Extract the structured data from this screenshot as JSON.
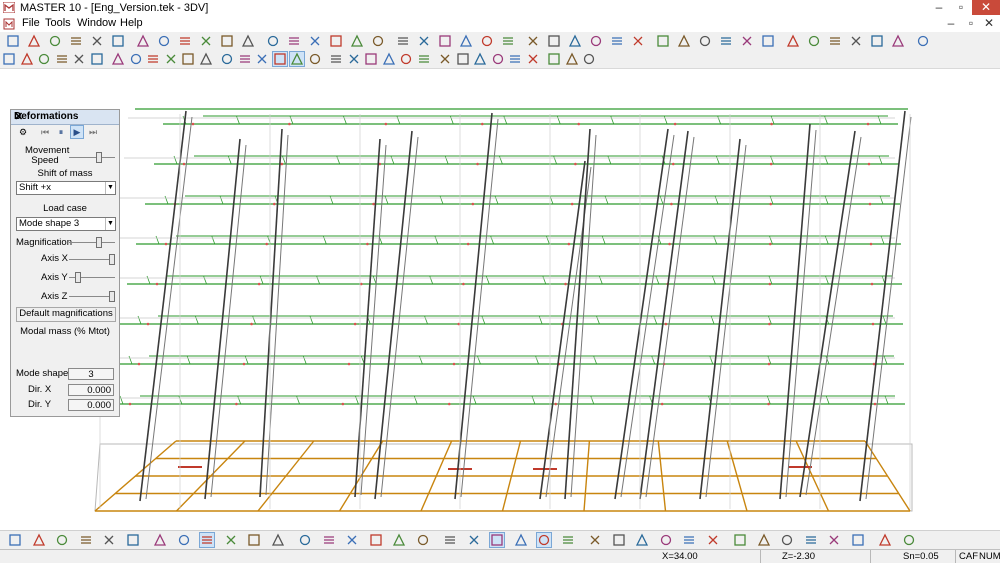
{
  "window": {
    "title": "MASTER 10 - [Eng_Version.tek - 3DV]"
  },
  "menu": {
    "file": "File",
    "tools": "Tools",
    "window": "Window",
    "help": "Help"
  },
  "panel": {
    "title": "Deformations",
    "movement_speed_label": "Movement\nSpeed",
    "shift_of_mass_label": "Shift of mass",
    "shift_value": "Shift +x",
    "load_case_label": "Load case",
    "load_case_value": "Mode shape 3",
    "magnification_label": "Magnification",
    "axis_x_label": "Axis X",
    "axis_y_label": "Axis Y",
    "axis_z_label": "Axis Z",
    "default_magnifications_label": "Default magnifications",
    "modal_mass_label": "Modal mass (% Mtot)",
    "mode_shape_label": "Mode shape",
    "mode_shape_value": "3",
    "dir_x_label": "Dir. X",
    "dir_x_value": "0.000",
    "dir_y_label": "Dir. Y",
    "dir_y_value": "0.000",
    "sliders": {
      "movement_speed": 0.65,
      "magnification": 0.65,
      "axis_x": 0.95,
      "axis_y": 0.15,
      "axis_z": 0.95
    }
  },
  "status": {
    "x": "X=34.00",
    "z": "Z=-2.30",
    "sn": "Sn=0.05",
    "caf": "CAF",
    "num": "NUM"
  },
  "colors": {
    "floor_green": "#2d9a2d",
    "base_orange": "#c8850f",
    "column_dark": "#3a3a3a",
    "accent": "#c94a3a"
  },
  "icons": {
    "toolbar1": [
      "new-file-icon",
      "open-folder-icon",
      "save-icon",
      "structure-icon",
      "copy-icon",
      "print-icon",
      "print-preview-icon",
      "export-icon",
      "measure-icon",
      "select-icon",
      "grid-icon",
      "line-icon",
      "circle-icon",
      "arc-icon",
      "text-icon",
      "support-icon",
      "beam-icon",
      "slab-icon",
      "wall-icon",
      "tools-icon",
      "gear-icon",
      "node-icon",
      "element-icon",
      "section-icon",
      "load-icon",
      "copy-element-icon",
      "mirror-icon",
      "rotate-icon",
      "hinge-icon",
      "spring-icon",
      "plate-icon",
      "frame-icon",
      "truss-icon",
      "table-icon",
      "results-icon",
      "diagram-icon",
      "reinforcement-icon",
      "check-icon",
      "pan-hand-icon",
      "zoom-window-icon",
      "fit-icon",
      "cross-icon",
      "printer-icon"
    ],
    "toolbar2": [
      "view-3d-icon",
      "render-icon",
      "cube-icon",
      "front-view-icon",
      "side-view-icon",
      "top-view-icon",
      "shading-icon",
      "hidden-line-icon",
      "section-cut-icon",
      "wireframe-icon",
      "node-numbers-icon",
      "element-numbers-icon",
      "local-axes-icon",
      "load-symbols-icon",
      "support-symbols-icon",
      "deformed-shape-icon",
      "perspective-icon",
      "box-view-1-icon",
      "box-view-2-icon",
      "box-view-3-icon",
      "box-view-4-icon",
      "box-view-5-icon",
      "box-view-6-icon",
      "box-view-7-icon",
      "level-1-icon",
      "level-2-icon",
      "level-3-icon",
      "level-4-icon",
      "arrow-left-icon",
      "arrow-right-icon",
      "arrow-up-icon",
      "arrow-down-icon",
      "open-file-icon"
    ],
    "bottom": [
      "undo-icon",
      "redo-icon",
      "info-icon",
      "zoom-in-icon",
      "zoom-out-icon",
      "zoom-window-icon",
      "zoom-previous-icon",
      "zoom-next-icon",
      "zoom-all-icon",
      "refresh-icon",
      "snap-icon",
      "ortho-icon",
      "distance-icon",
      "angle-icon",
      "grab-icon",
      "cursor-icon",
      "layer-icon",
      "copy-layer-icon",
      "a-text-icon",
      "grid-snap-icon",
      "m-icon",
      "a-icon",
      "cross-box-icon",
      "plus-minus-icon",
      "mouse-icon",
      "crosshair-icon",
      "filter-1-icon",
      "filter-2-icon",
      "filter-3-icon",
      "filter-4-icon",
      "filter-5-icon",
      "filter-6-icon",
      "filter-7-icon",
      "filter-8-icon",
      "filter-9-icon",
      "filter-10-icon",
      "filter-11-icon",
      "filter-12-icon"
    ]
  }
}
